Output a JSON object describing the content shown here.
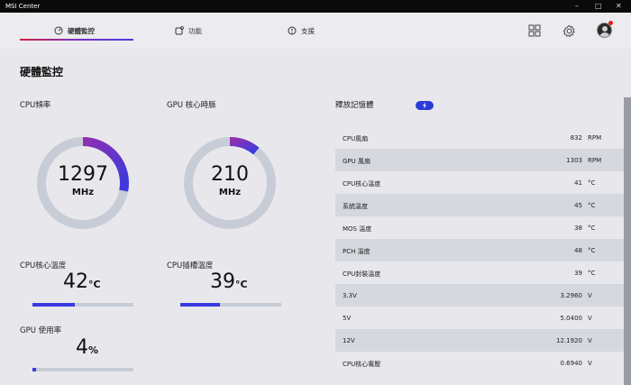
{
  "window": {
    "title": "MSI Center"
  },
  "tabs": [
    {
      "label": "硬體監控"
    },
    {
      "label": "功能"
    },
    {
      "label": "支援"
    }
  ],
  "page": {
    "title": "硬體監控"
  },
  "cpu_freq": {
    "label": "CPU頻率",
    "value": "1297",
    "unit": "MHz",
    "fraction": 0.28
  },
  "gpu_clock": {
    "label": "GPU 核心時脈",
    "value": "210",
    "unit": "MHz",
    "fraction": 0.11
  },
  "cpu_temp": {
    "label": "CPU核心溫度",
    "value": "42",
    "unit": "°C",
    "fraction": 0.42
  },
  "cpu_socket_temp": {
    "label": "CPU插槽溫度",
    "value": "39",
    "unit": "°C",
    "fraction": 0.39
  },
  "gpu_usage": {
    "label": "GPU 使用率",
    "value": "4",
    "unit": "%",
    "fraction": 0.04
  },
  "release": {
    "title": "釋放記憶體",
    "button_icon": "lightning-icon"
  },
  "sensors": [
    {
      "name": "CPU風扇",
      "value": "832",
      "unit": "RPM"
    },
    {
      "name": "GPU 風扇",
      "value": "1303",
      "unit": "RPM"
    },
    {
      "name": "CPU核心溫度",
      "value": "41",
      "unit": "°C"
    },
    {
      "name": "系統溫度",
      "value": "45",
      "unit": "°C"
    },
    {
      "name": "MOS 溫度",
      "value": "38",
      "unit": "°C"
    },
    {
      "name": "PCH 溫度",
      "value": "48",
      "unit": "°C"
    },
    {
      "name": "CPU封裝溫度",
      "value": "39",
      "unit": "°C"
    },
    {
      "name": "3.3V",
      "value": "3.2960",
      "unit": "V"
    },
    {
      "name": "5V",
      "value": "5.0400",
      "unit": "V"
    },
    {
      "name": "12V",
      "value": "12.1920",
      "unit": "V"
    },
    {
      "name": "CPU核心電壓",
      "value": "0.6940",
      "unit": "V"
    }
  ],
  "colors": {
    "accent": "#3a3ae0",
    "gauge_track": "#c8ccd6",
    "gauge_start": "#9030b0"
  }
}
